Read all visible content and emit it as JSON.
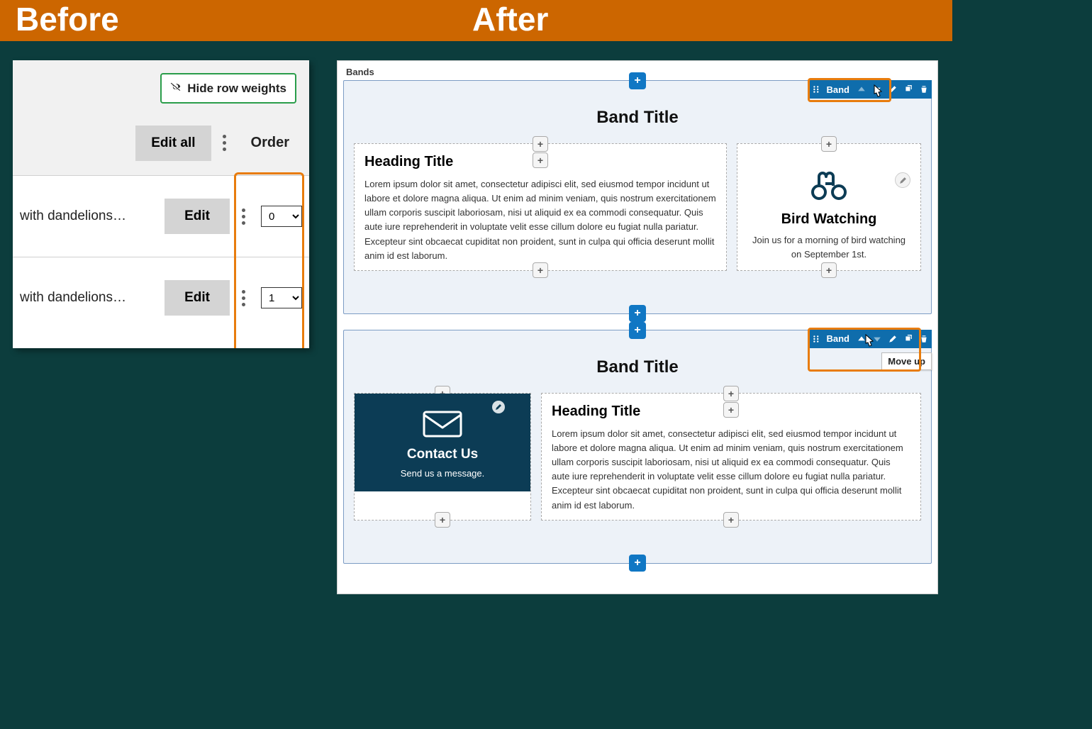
{
  "banner": {
    "before": "Before",
    "after": "After"
  },
  "before_panel": {
    "hide_row_weights": "Hide row weights",
    "edit_all": "Edit all",
    "order_heading": "Order",
    "rows": [
      {
        "text": "with dandelions…",
        "edit": "Edit",
        "order": "0"
      },
      {
        "text": "with dandelions…",
        "edit": "Edit",
        "order": "1"
      }
    ]
  },
  "after_panel": {
    "bands_label": "Bands",
    "toolbar_band_label": "Band",
    "tooltip": "Move up",
    "band1": {
      "title": "Band Title",
      "heading": "Heading Title",
      "lorem": "Lorem ipsum dolor sit amet, consectetur adipisci elit, sed eiusmod tempor incidunt ut labore et dolore magna aliqua. Ut enim ad minim veniam, quis nostrum exercitationem ullam corporis suscipit laboriosam, nisi ut aliquid ex ea commodi consequatur. Quis aute iure reprehenderit in voluptate velit esse cillum dolore eu fugiat nulla pariatur. Excepteur sint obcaecat cupiditat non proident, sunt in culpa qui officia deserunt mollit anim id est laborum.",
      "bird_title": "Bird Watching",
      "bird_sub": "Join us for a morning of bird watching on September 1st."
    },
    "band2": {
      "title": "Band Title",
      "contact_title": "Contact Us",
      "contact_sub": "Send us a message.",
      "heading": "Heading Title",
      "lorem": "Lorem ipsum dolor sit amet, consectetur adipisci elit, sed eiusmod tempor incidunt ut labore et dolore magna aliqua. Ut enim ad minim veniam, quis nostrum exercitationem ullam corporis suscipit laboriosam, nisi ut aliquid ex ea commodi consequatur. Quis aute iure reprehenderit in voluptate velit esse cillum dolore eu fugiat nulla pariatur. Excepteur sint obcaecat cupiditat non proident, sunt in culpa qui officia deserunt mollit anim id est laborum."
    }
  }
}
